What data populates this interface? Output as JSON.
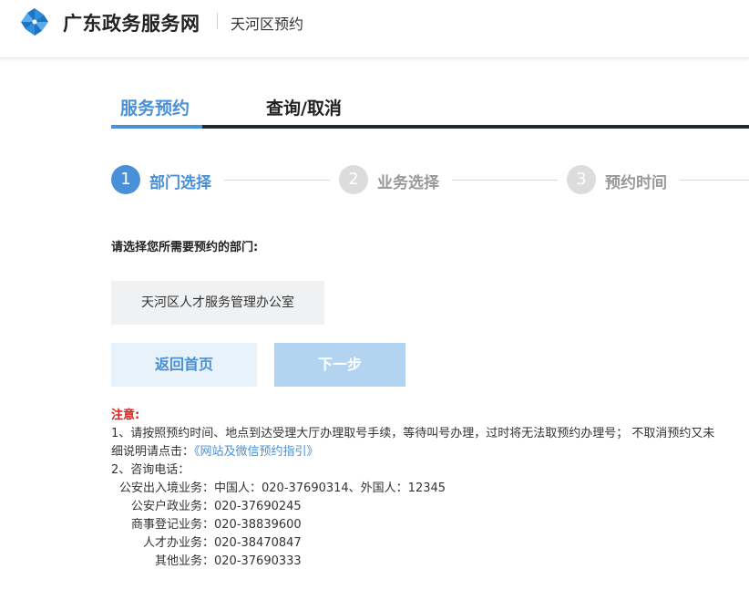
{
  "header": {
    "site_title": "广东政务服务网",
    "district": "天河区预约",
    "logo_icon": "pinwheel-logo-icon",
    "brand_color": "#2f8fd8"
  },
  "tabs": [
    {
      "label": "服务预约",
      "active": true
    },
    {
      "label": "查询/取消",
      "active": false
    }
  ],
  "steps": [
    {
      "number": "1",
      "label": "部门选择",
      "active": true
    },
    {
      "number": "2",
      "label": "业务选择",
      "active": false
    },
    {
      "number": "3",
      "label": "预约时间",
      "active": false
    }
  ],
  "main": {
    "prompt": "请选择您所需要预约的部门:",
    "department_option": "天河区人才服务管理办公室",
    "back_home_label": "返回首页",
    "next_label": "下一步"
  },
  "notice": {
    "title": "注意:",
    "item1_text": "1、请按照预约时间、地点到达受理大厅办理取号手续，等待叫号办理，过时将无法取预约办理号； 不取消预约又未",
    "item1_cont_prefix": "细说明请点击：",
    "guide_link": "《网站及微信预约指引》",
    "item2_title": "2、咨询电话：",
    "phones": [
      {
        "label": "公安出入境业务：",
        "value": "中国人：020-37690314、外国人：12345"
      },
      {
        "label": "公安户政业务：",
        "value": "020-37690245"
      },
      {
        "label": "商事登记业务：",
        "value": "020-38839600"
      },
      {
        "label": "人才办业务：",
        "value": "020-38470847"
      },
      {
        "label": "其他业务：",
        "value": "020-37690333"
      }
    ]
  },
  "colors": {
    "accent": "#4a90d9",
    "notice_red": "#e0201c",
    "tab_bar_dark": "#1f2a36",
    "step_inactive": "#dcdcdc"
  }
}
